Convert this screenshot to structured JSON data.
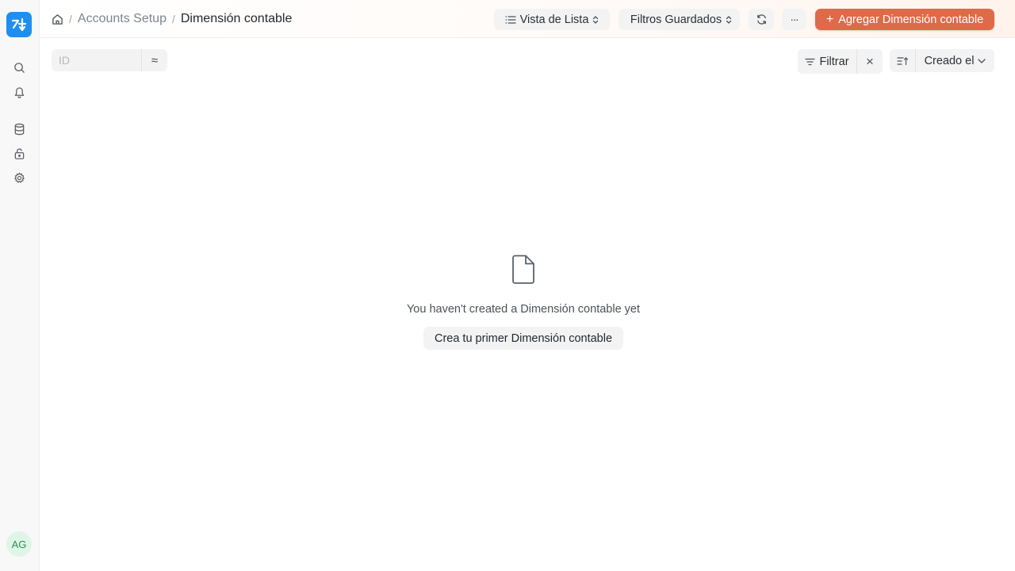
{
  "sidebar": {
    "logo_icon": "app-logo-icon",
    "icons": [
      "search-icon",
      "bell-icon",
      "database-icon",
      "lock-icon",
      "gear-icon"
    ],
    "avatar_initials": "AG"
  },
  "breadcrumb": {
    "home_icon": "home-icon",
    "separator": "/",
    "parent": "Accounts Setup",
    "current": "Dimensión contable"
  },
  "header": {
    "view_selector": "Vista de Lista",
    "saved_filters": "Filtros Guardados",
    "refresh_icon": "refresh-icon",
    "more_label": "···",
    "primary_plus": "+",
    "primary_label": "Agregar Dimensión contable"
  },
  "toolbar": {
    "id_placeholder": "ID",
    "id_operator": "≈",
    "filter_label": "Filtrar",
    "clear_label": "×",
    "sort_label": "Creado el"
  },
  "empty_state": {
    "message": "You haven't created a Dimensión contable yet",
    "button_label": "Crea tu primer Dimensión contable"
  },
  "colors": {
    "primary_button": "#de6a4a",
    "logo": "#1f8ef1",
    "avatar_bg": "#dff5e7",
    "avatar_text": "#2e8b57"
  }
}
